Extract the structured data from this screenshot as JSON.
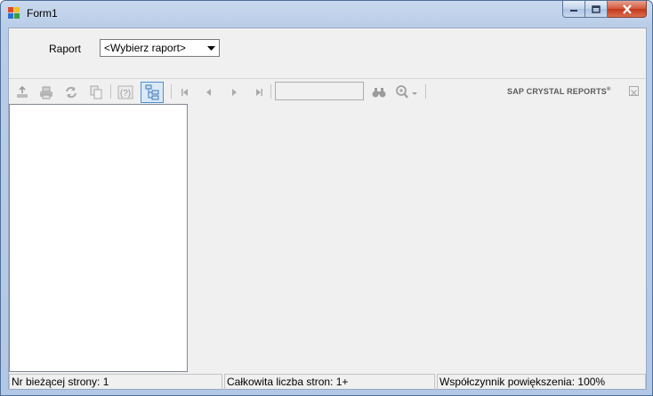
{
  "window": {
    "title": "Form1"
  },
  "params": {
    "raport_label": "Raport",
    "raport_select_value": "<Wybierz raport>"
  },
  "viewer": {
    "toolbar": {
      "icons": [
        "export-icon",
        "print-icon",
        "refresh-icon",
        "copy-icon",
        "parameters-icon",
        "group-tree-toggle-icon",
        "first-page-icon",
        "previous-page-icon",
        "next-page-icon",
        "last-page-icon",
        "find-icon",
        "zoom-icon"
      ],
      "goto_page_value": "",
      "brand": "SAP CRYSTAL REPORTS",
      "brand_mark": "®"
    },
    "status": {
      "current_page": "Nr bieżącej strony: 1",
      "total_pages": "Całkowita liczba stron: 1+",
      "zoom": "Współczynnik powiększenia: 100%"
    }
  },
  "colors": {
    "frame": "#b9cde8",
    "client_bg": "#f0f0f0",
    "close_button": "#c3371a",
    "active_toolbar_border": "#4d8fd3"
  }
}
